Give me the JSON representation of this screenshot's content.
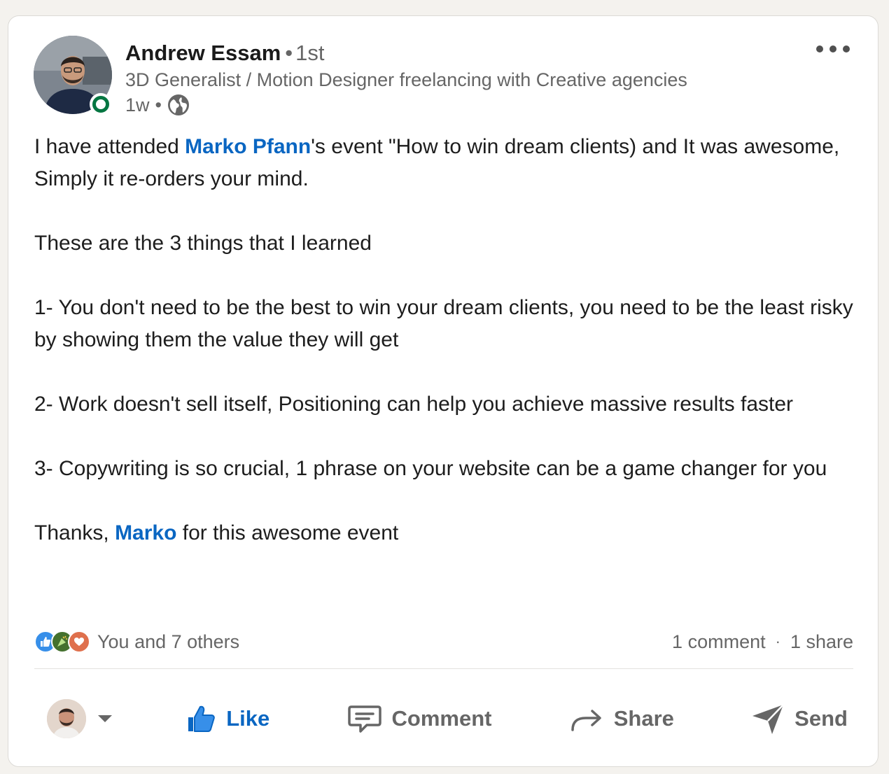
{
  "author": {
    "name": "Andrew Essam",
    "degree": "1st",
    "headline": "3D Generalist / Motion Designer freelancing with Creative agencies",
    "time": "1w",
    "visibility_icon": "globe-icon",
    "online": true
  },
  "post": {
    "p1_before": "I have attended ",
    "p1_mention": "Marko Pfann",
    "p1_after": "'s event \"How to win dream clients) and It was awesome, Simply it re-orders your mind.",
    "p2": "These are the 3 things that I learned",
    "p3": "1- You don't need to be the best to win your dream clients, you need to be the least risky by showing them the value they will get",
    "p4": "2- Work doesn't sell itself, Positioning can help you achieve massive results faster",
    "p5": "3- Copywriting is so crucial, 1 phrase on your website can be a game changer for you",
    "p6_before": "Thanks, ",
    "p6_mention": "Marko",
    "p6_after": " for this awesome event"
  },
  "social": {
    "reaction_icons": [
      "like-reaction-icon",
      "celebrate-reaction-icon",
      "love-reaction-icon"
    ],
    "reactions_text": "You and 7 others",
    "comments": "1 comment",
    "separator": "·",
    "shares": "1 share"
  },
  "actions": {
    "like": "Like",
    "comment": "Comment",
    "share": "Share",
    "send": "Send"
  },
  "colors": {
    "accent": "#0a66c2",
    "online": "#057642",
    "muted_text": "#666666",
    "page_bg": "#f4f2ee"
  }
}
